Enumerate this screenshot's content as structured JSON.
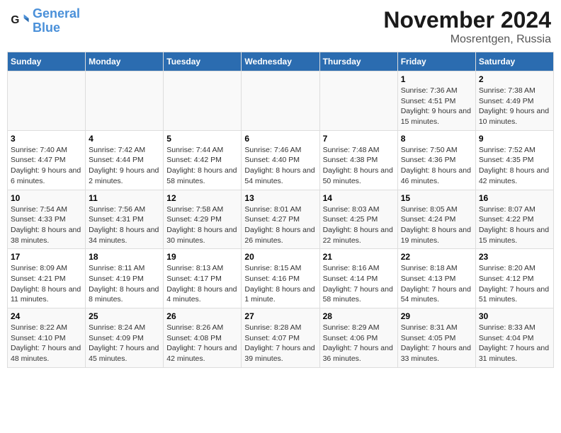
{
  "logo": {
    "line1": "General",
    "line2": "Blue"
  },
  "title": "November 2024",
  "subtitle": "Mosrentgen, Russia",
  "days_of_week": [
    "Sunday",
    "Monday",
    "Tuesday",
    "Wednesday",
    "Thursday",
    "Friday",
    "Saturday"
  ],
  "weeks": [
    [
      {
        "num": "",
        "info": ""
      },
      {
        "num": "",
        "info": ""
      },
      {
        "num": "",
        "info": ""
      },
      {
        "num": "",
        "info": ""
      },
      {
        "num": "",
        "info": ""
      },
      {
        "num": "1",
        "info": "Sunrise: 7:36 AM\nSunset: 4:51 PM\nDaylight: 9 hours and 15 minutes."
      },
      {
        "num": "2",
        "info": "Sunrise: 7:38 AM\nSunset: 4:49 PM\nDaylight: 9 hours and 10 minutes."
      }
    ],
    [
      {
        "num": "3",
        "info": "Sunrise: 7:40 AM\nSunset: 4:47 PM\nDaylight: 9 hours and 6 minutes."
      },
      {
        "num": "4",
        "info": "Sunrise: 7:42 AM\nSunset: 4:44 PM\nDaylight: 9 hours and 2 minutes."
      },
      {
        "num": "5",
        "info": "Sunrise: 7:44 AM\nSunset: 4:42 PM\nDaylight: 8 hours and 58 minutes."
      },
      {
        "num": "6",
        "info": "Sunrise: 7:46 AM\nSunset: 4:40 PM\nDaylight: 8 hours and 54 minutes."
      },
      {
        "num": "7",
        "info": "Sunrise: 7:48 AM\nSunset: 4:38 PM\nDaylight: 8 hours and 50 minutes."
      },
      {
        "num": "8",
        "info": "Sunrise: 7:50 AM\nSunset: 4:36 PM\nDaylight: 8 hours and 46 minutes."
      },
      {
        "num": "9",
        "info": "Sunrise: 7:52 AM\nSunset: 4:35 PM\nDaylight: 8 hours and 42 minutes."
      }
    ],
    [
      {
        "num": "10",
        "info": "Sunrise: 7:54 AM\nSunset: 4:33 PM\nDaylight: 8 hours and 38 minutes."
      },
      {
        "num": "11",
        "info": "Sunrise: 7:56 AM\nSunset: 4:31 PM\nDaylight: 8 hours and 34 minutes."
      },
      {
        "num": "12",
        "info": "Sunrise: 7:58 AM\nSunset: 4:29 PM\nDaylight: 8 hours and 30 minutes."
      },
      {
        "num": "13",
        "info": "Sunrise: 8:01 AM\nSunset: 4:27 PM\nDaylight: 8 hours and 26 minutes."
      },
      {
        "num": "14",
        "info": "Sunrise: 8:03 AM\nSunset: 4:25 PM\nDaylight: 8 hours and 22 minutes."
      },
      {
        "num": "15",
        "info": "Sunrise: 8:05 AM\nSunset: 4:24 PM\nDaylight: 8 hours and 19 minutes."
      },
      {
        "num": "16",
        "info": "Sunrise: 8:07 AM\nSunset: 4:22 PM\nDaylight: 8 hours and 15 minutes."
      }
    ],
    [
      {
        "num": "17",
        "info": "Sunrise: 8:09 AM\nSunset: 4:21 PM\nDaylight: 8 hours and 11 minutes."
      },
      {
        "num": "18",
        "info": "Sunrise: 8:11 AM\nSunset: 4:19 PM\nDaylight: 8 hours and 8 minutes."
      },
      {
        "num": "19",
        "info": "Sunrise: 8:13 AM\nSunset: 4:17 PM\nDaylight: 8 hours and 4 minutes."
      },
      {
        "num": "20",
        "info": "Sunrise: 8:15 AM\nSunset: 4:16 PM\nDaylight: 8 hours and 1 minute."
      },
      {
        "num": "21",
        "info": "Sunrise: 8:16 AM\nSunset: 4:14 PM\nDaylight: 7 hours and 58 minutes."
      },
      {
        "num": "22",
        "info": "Sunrise: 8:18 AM\nSunset: 4:13 PM\nDaylight: 7 hours and 54 minutes."
      },
      {
        "num": "23",
        "info": "Sunrise: 8:20 AM\nSunset: 4:12 PM\nDaylight: 7 hours and 51 minutes."
      }
    ],
    [
      {
        "num": "24",
        "info": "Sunrise: 8:22 AM\nSunset: 4:10 PM\nDaylight: 7 hours and 48 minutes."
      },
      {
        "num": "25",
        "info": "Sunrise: 8:24 AM\nSunset: 4:09 PM\nDaylight: 7 hours and 45 minutes."
      },
      {
        "num": "26",
        "info": "Sunrise: 8:26 AM\nSunset: 4:08 PM\nDaylight: 7 hours and 42 minutes."
      },
      {
        "num": "27",
        "info": "Sunrise: 8:28 AM\nSunset: 4:07 PM\nDaylight: 7 hours and 39 minutes."
      },
      {
        "num": "28",
        "info": "Sunrise: 8:29 AM\nSunset: 4:06 PM\nDaylight: 7 hours and 36 minutes."
      },
      {
        "num": "29",
        "info": "Sunrise: 8:31 AM\nSunset: 4:05 PM\nDaylight: 7 hours and 33 minutes."
      },
      {
        "num": "30",
        "info": "Sunrise: 8:33 AM\nSunset: 4:04 PM\nDaylight: 7 hours and 31 minutes."
      }
    ]
  ]
}
